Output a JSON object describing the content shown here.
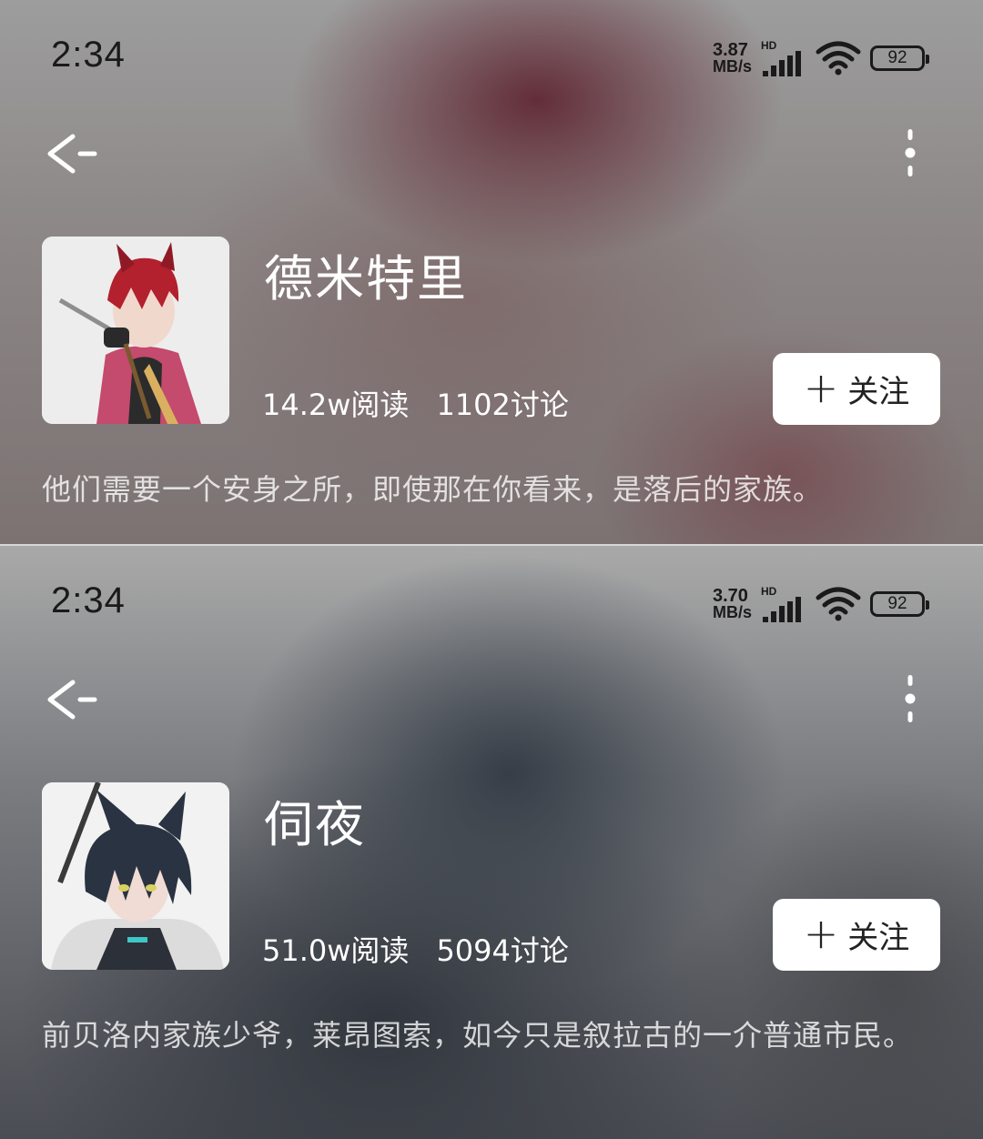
{
  "cards": [
    {
      "status": {
        "time": "2:34",
        "net_speed_value": "3.87",
        "net_speed_unit": "MB/s",
        "network_label": "HD",
        "battery": "92"
      },
      "title": "德米特里",
      "stats": {
        "reads": "14.2w阅读",
        "discussions": "1102讨论"
      },
      "follow_label": "关注",
      "description": "他们需要一个安身之所，即使那在你看来，是落后的家族。",
      "colors": {
        "background": "#8c8686",
        "accent": "#603034"
      }
    },
    {
      "status": {
        "time": "2:34",
        "net_speed_value": "3.70",
        "net_speed_unit": "MB/s",
        "network_label": "HD",
        "battery": "92"
      },
      "title": "伺夜",
      "stats": {
        "reads": "51.0w阅读",
        "discussions": "5094讨论"
      },
      "follow_label": "关注",
      "description": "前贝洛内家族少爷，莱昂图索，如今只是叙拉古的一介普通市民。",
      "colors": {
        "background": "#4a4d53",
        "accent": "#323a44"
      }
    }
  ],
  "icons": {
    "back": "back-arrow-icon",
    "more": "more-vertical-icon",
    "signal": "signal-icon",
    "wifi": "wifi-icon",
    "battery": "battery-icon"
  }
}
